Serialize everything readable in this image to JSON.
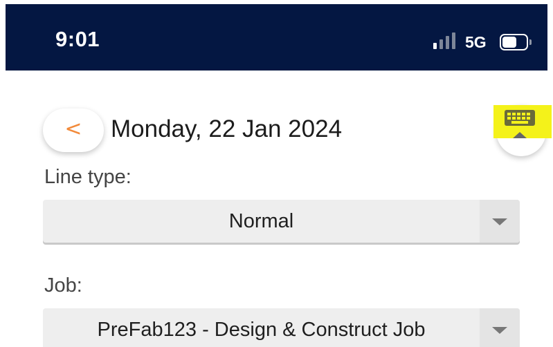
{
  "status_bar": {
    "time": "9:01",
    "network": "5G",
    "signal_bars_active": 1,
    "signal_bars_total": 4,
    "battery_level": 0.5
  },
  "header": {
    "back_label": "<",
    "date_title": "Monday, 22 Jan 2024",
    "keyboard_icon": "keyboard-hide-icon"
  },
  "form": {
    "line_type_label": "Line type:",
    "line_type_value": "Normal",
    "job_label": "Job:",
    "job_value": "PreFab123 - Design & Construct Job"
  },
  "colors": {
    "status_bar_bg": "#041742",
    "accent_orange": "#f28a3a",
    "highlight_yellow": "#f4f21a",
    "select_bg": "#eeeeee"
  }
}
